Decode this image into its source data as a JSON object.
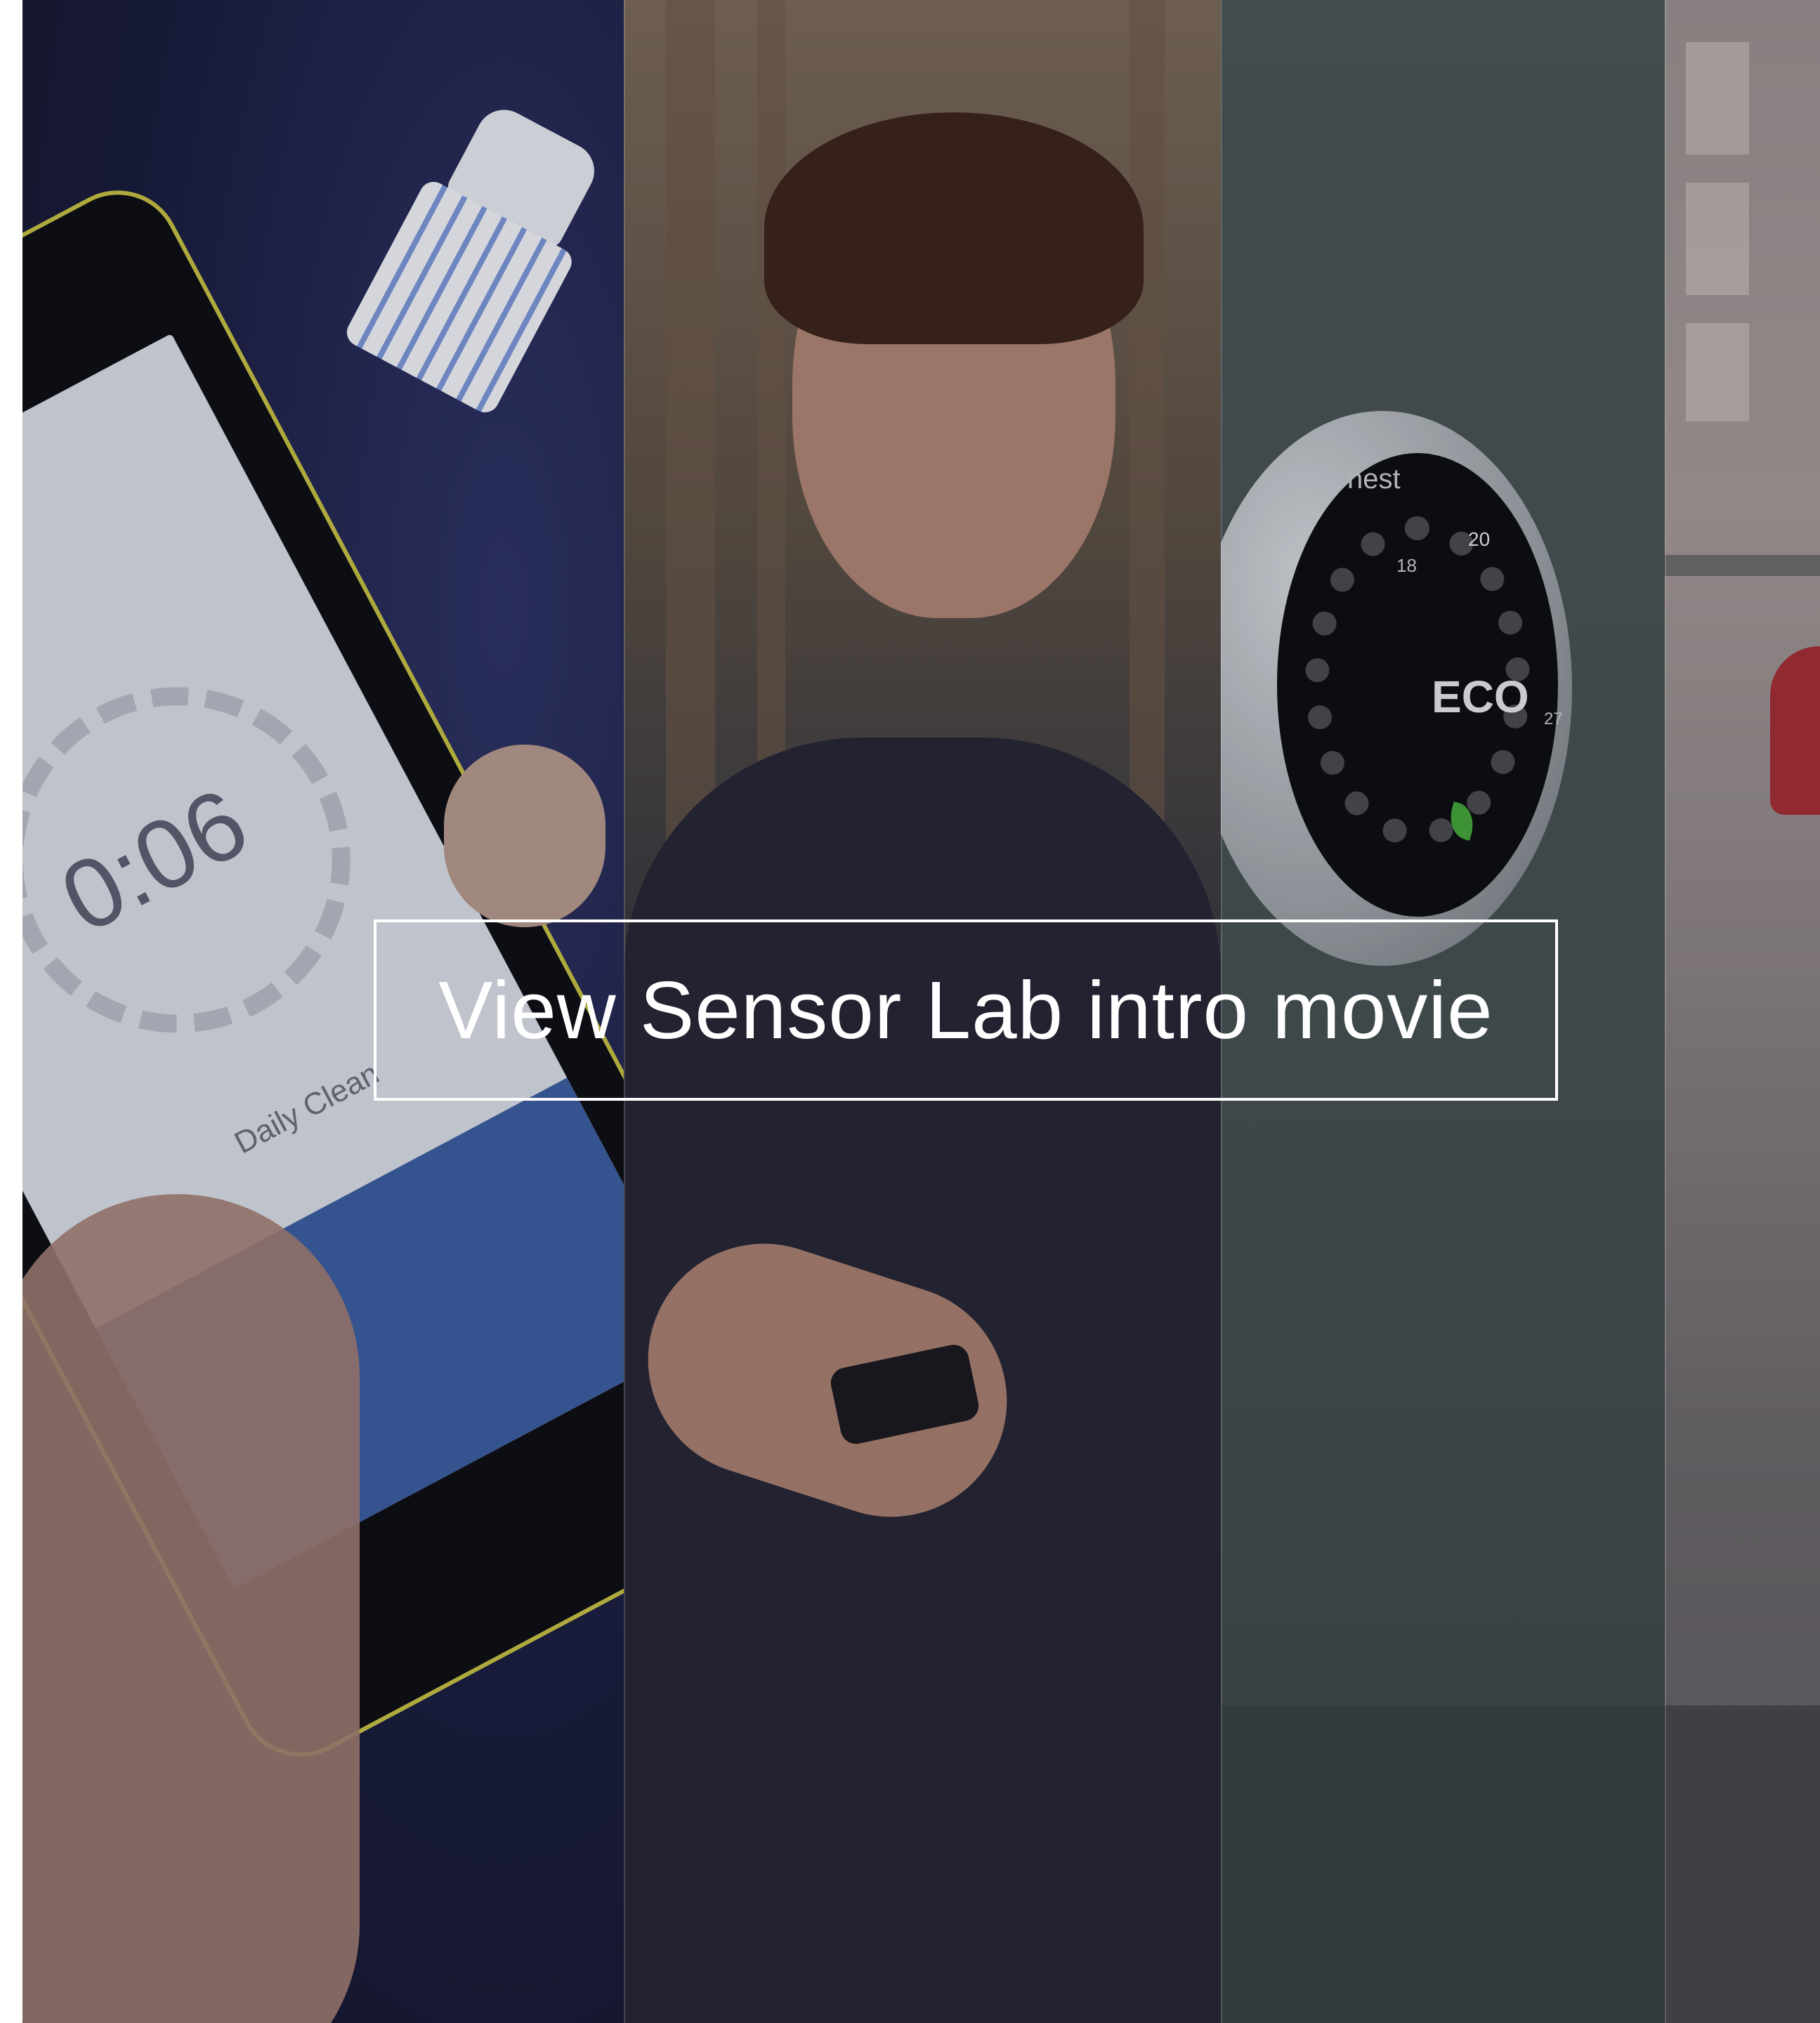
{
  "hero": {
    "cta_label": "View Sensor Lab intro movie",
    "panels": [
      {
        "name": "smartphone-toothbrush-app",
        "screen_time": "0:06",
        "screen_caption": "Daily Clean"
      },
      {
        "name": "runner-checking-smartwatch"
      },
      {
        "name": "nest-thermostat",
        "brand": "nest",
        "mode": "ECO",
        "scale_marks": [
          "18",
          "20",
          "27"
        ]
      },
      {
        "name": "blurred-interior"
      }
    ]
  },
  "colors": {
    "cta_border": "#ffffff",
    "cta_text": "#ffffff",
    "eco_leaf": "#45a63b",
    "phone_frame": "#c7c143"
  },
  "icons": {
    "eco_leaf": "leaf-icon",
    "play_trigger": "cta-frame"
  }
}
